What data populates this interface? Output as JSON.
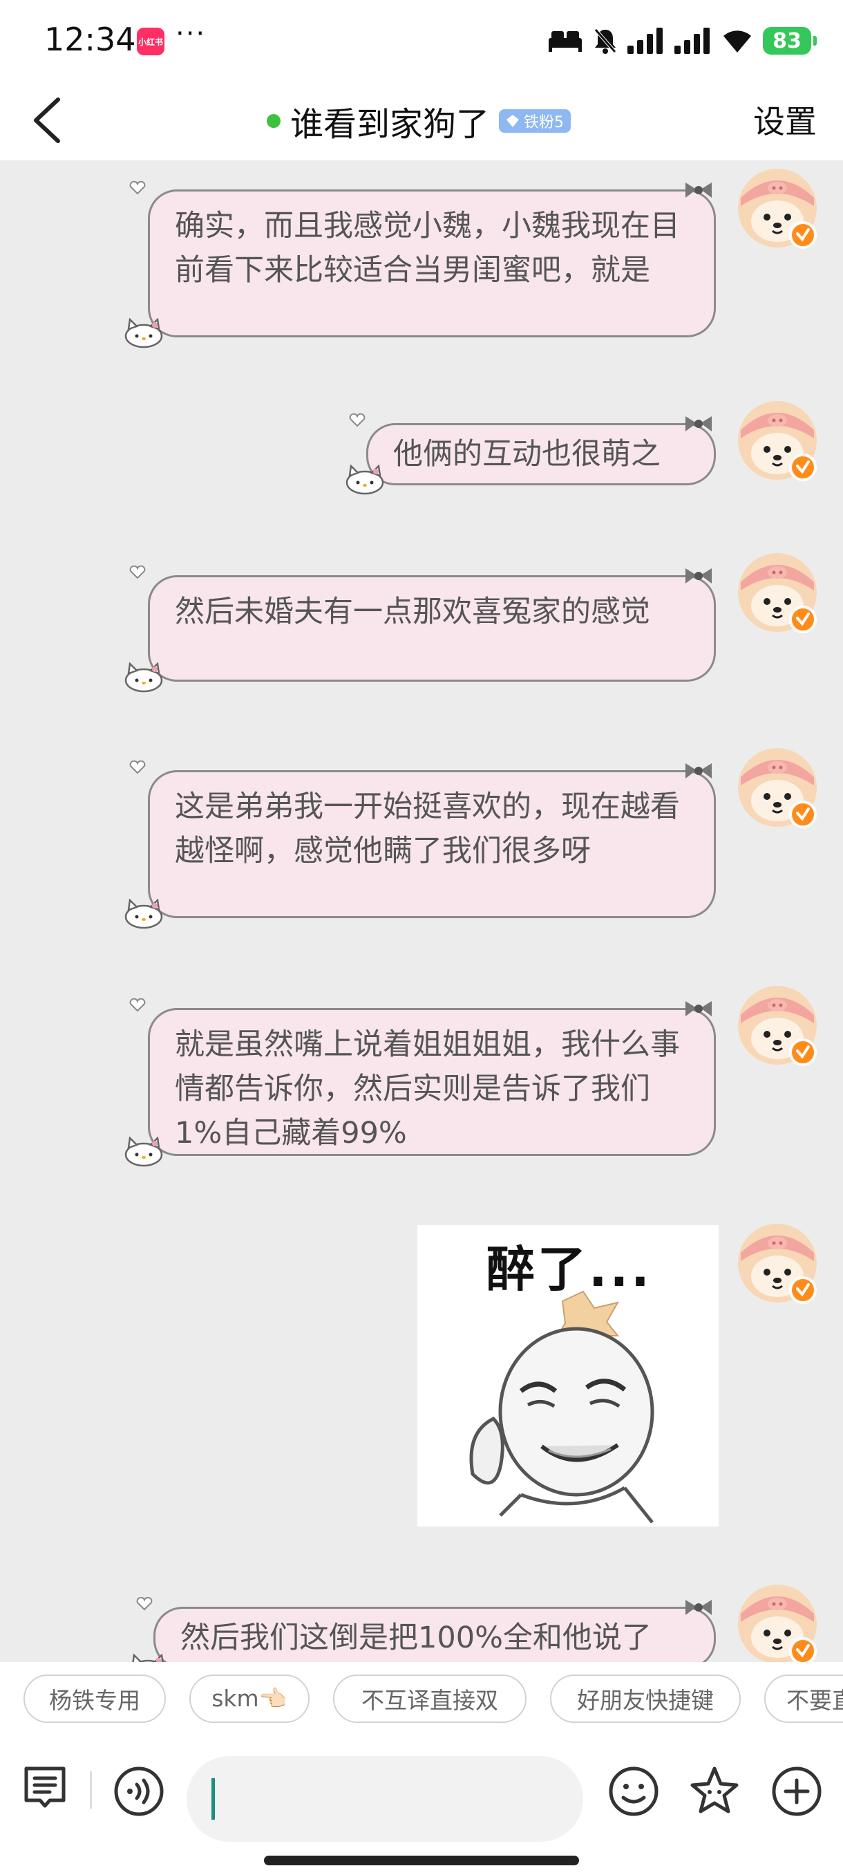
{
  "status": {
    "time": "12:34",
    "app_badge": "小红书",
    "dots": "···",
    "battery": "83"
  },
  "header": {
    "title": "谁看到家狗了",
    "fan_badge": "铁粉5",
    "settings": "设置"
  },
  "messages": [
    {
      "text": "确实，而且我感觉小魏，小魏我现在目前看下来比较适合当男闺蜜吧，就是"
    },
    {
      "text": "他俩的互动也很萌之"
    },
    {
      "text": "然后未婚夫有一点那欢喜冤家的感觉"
    },
    {
      "text": "这是弟弟我一开始挺喜欢的，现在越看越怪啊，感觉他瞒了我们很多呀"
    },
    {
      "text": "就是虽然嘴上说着姐姐姐姐，我什么事情都告诉你，然后实则是告诉了我们1%自己藏着99%"
    },
    {
      "text": "然后我们这倒是把100%全和他说了"
    }
  ],
  "sticker": {
    "caption": "醉了..."
  },
  "quick_replies": [
    "杨铁专用",
    "skm👈🏻",
    "不互译直接双",
    "好朋友快捷键",
    "不要直"
  ],
  "colors": {
    "bubble_bg": "#f8e6ec",
    "online": "#3ec13e",
    "verified": "#ff8c1a",
    "caret": "#1a8f7e"
  }
}
